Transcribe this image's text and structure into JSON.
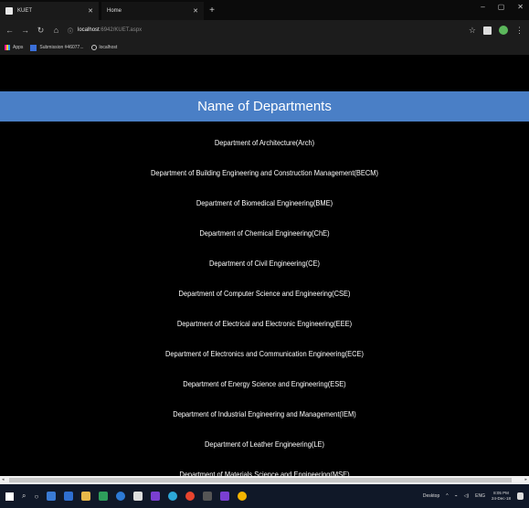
{
  "browser": {
    "tabs": [
      {
        "title": "KUET"
      },
      {
        "title": "Home"
      }
    ],
    "new_tab": "+",
    "window_controls": [
      "–",
      "▢",
      "✕"
    ],
    "url_host": "localhost",
    "url_rest": ":6942/KUET.aspx",
    "bookmarks": [
      {
        "label": "Apps"
      },
      {
        "label": "Submission #46077..."
      },
      {
        "label": "localhost"
      }
    ]
  },
  "page": {
    "heading": "Name of Departments",
    "departments": [
      "Department of Architecture(Arch)",
      "Department of Building Engineering and Construction Management(BECM)",
      "Department of Biomedical Engineering(BME)",
      "Department of Chemical Engineering(ChE)",
      "Department of Civil Engineering(CE)",
      "Department of Computer Science and Engineering(CSE)",
      "Department of Electrical and Electronic Engineering(EEE)",
      "Department of Electronics and Communication Engineering(ECE)",
      "Department of Energy Science and Engineering(ESE)",
      "Department of Industrial Engineering and Management(IEM)",
      "Department of Leather Engineering(LE)",
      "Department of Materials Science and Engineering(MSE)"
    ]
  },
  "taskbar": {
    "tray_label": "Desktop",
    "language": "ENG",
    "time": "8:05 PM",
    "date": "24-Dec-18"
  },
  "colors": {
    "header_band": "#4a7fc6",
    "page_background": "#000000",
    "taskbar": "#101828"
  }
}
